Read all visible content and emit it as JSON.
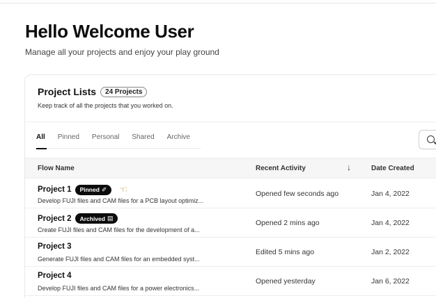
{
  "header": {
    "title": "Hello Welcome User",
    "subtitle": "Manage all your projects and enjoy your play ground"
  },
  "card": {
    "title": "Project Lists",
    "count": "24 Projects",
    "description": "Keep track of all the projects that you worked on."
  },
  "tabs": [
    {
      "label": "All",
      "active": true
    },
    {
      "label": "Pinned",
      "active": false
    },
    {
      "label": "Personal",
      "active": false
    },
    {
      "label": "Shared",
      "active": false
    },
    {
      "label": "Archive",
      "active": false
    }
  ],
  "search": {
    "icon": "search-icon"
  },
  "table": {
    "columns": {
      "flow_name": "Flow Name",
      "recent_activity": "Recent Activity",
      "date_created": "Date Created"
    },
    "sort_icon": "arrow-down-icon",
    "rows": [
      {
        "name": "Project 1",
        "badge": "Pinned",
        "badge_icon": "pin-icon",
        "extra_icon": "pointing-hand-icon",
        "description": "Develop FUJI files and CAM files for a PCB layout optimiz...",
        "activity": "Opened few seconds ago",
        "date": "Jan 4, 2022"
      },
      {
        "name": "Project 2",
        "badge": "Archived",
        "badge_icon": "archive-icon",
        "description": "Create FUJI files and CAM files for the development of a...",
        "activity": "Opened 2 mins ago",
        "date": "Jan 4, 2022"
      },
      {
        "name": "Project 3",
        "badge": "",
        "description": " Generate FUJI files and CAM files for an embedded syst...",
        "activity": "Edited 5 mins ago",
        "date": "Jan 2, 2022"
      },
      {
        "name": "Project 4",
        "badge": "",
        "description": "Develop FUJI files and CAM files for a power electronics...",
        "activity": "Opened yesterday",
        "date": "Jan 6, 2022"
      }
    ]
  }
}
